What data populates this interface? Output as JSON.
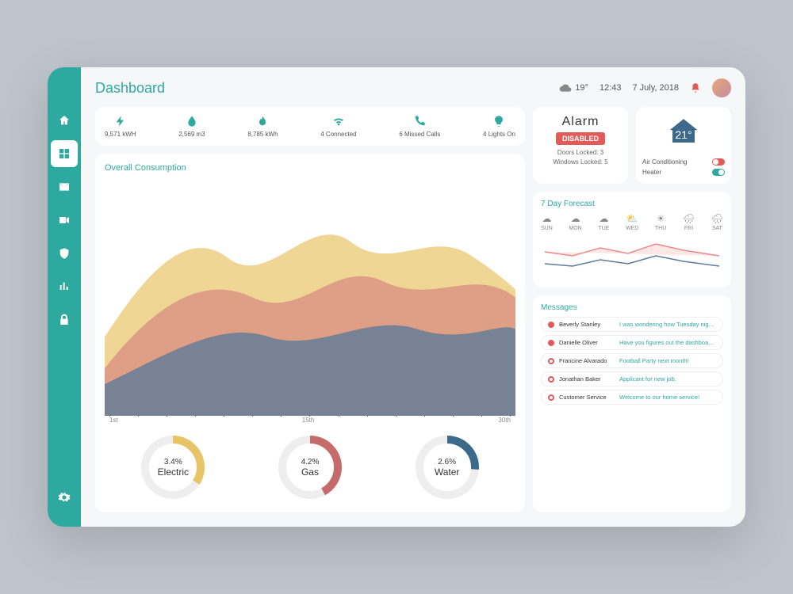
{
  "header": {
    "title": "Dashboard",
    "temp": "19°",
    "time": "12:43",
    "date": "7 July, 2018"
  },
  "stats": [
    {
      "icon": "bolt",
      "value": "9,571 kWH"
    },
    {
      "icon": "drop",
      "value": "2,569 m3"
    },
    {
      "icon": "flame",
      "value": "8,785 kWh"
    },
    {
      "icon": "wifi",
      "value": "4 Connected"
    },
    {
      "icon": "phone",
      "value": "6 Missed Calls"
    },
    {
      "icon": "bulb",
      "value": "4 Lights On"
    }
  ],
  "chart_data": {
    "type": "area",
    "title": "Overall Consumption",
    "xlabel": "",
    "ylabel": "",
    "x_ticks": [
      "1st",
      "15th",
      "30th"
    ],
    "series": [
      {
        "name": "Electric",
        "color": "#e8c468"
      },
      {
        "name": "Gas",
        "color": "#d98880"
      },
      {
        "name": "Water",
        "color": "#5d7a99"
      }
    ],
    "donuts": [
      {
        "name": "Electric",
        "pct": "3.4%",
        "value": 34,
        "color": "#e8c468"
      },
      {
        "name": "Gas",
        "pct": "4.2%",
        "value": 42,
        "color": "#c66b6b"
      },
      {
        "name": "Water",
        "pct": "2.6%",
        "value": 26,
        "color": "#3d6a8a"
      }
    ]
  },
  "alarm": {
    "title": "Alarm",
    "status": "DISABLED",
    "doors": "Doors Locked: 3",
    "windows": "Windows Locked: 5"
  },
  "thermo": {
    "temp": "21°",
    "ac": "Air Conditioning",
    "heater": "Heater"
  },
  "forecast": {
    "title": "7 Day Forecast",
    "days": [
      "SUN",
      "MON",
      "TUE",
      "WED",
      "THU",
      "FRI",
      "SAT"
    ]
  },
  "messages": {
    "title": "Messages",
    "items": [
      {
        "name": "Beverly Stanley",
        "text": "I was wondering how Tuesday night..",
        "unread": true
      },
      {
        "name": "Danielle Oliver",
        "text": "Have you figures out the dashboard?",
        "unread": true
      },
      {
        "name": "Francine Alvarado",
        "text": "Football Party next month!",
        "unread": false
      },
      {
        "name": "Jonathan Baker",
        "text": "Applicant for new job.",
        "unread": false
      },
      {
        "name": "Customer Service",
        "text": "Welcome to our home service!",
        "unread": false
      }
    ]
  }
}
